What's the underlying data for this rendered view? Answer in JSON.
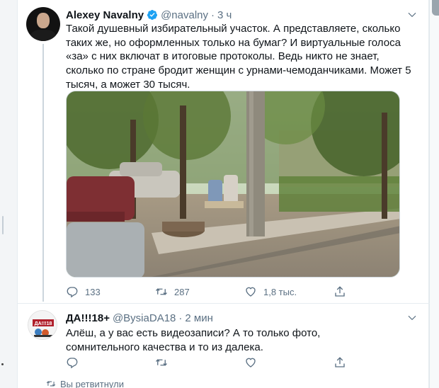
{
  "tweet": {
    "author_name": "Alexey Navalny",
    "handle": "@navalny",
    "separator": "·",
    "time": "3 ч",
    "text": "Такой душевный избирательный участок. А представляете, сколько таких же, но оформленных только на бумаг? И виртуальные голоса «за» с них включат в итоговые протоколы. Ведь никто не знает, сколько по стране бродит женщин с урнами-чемоданчиками. Может 5 тысяч, а может 30 тысяч.",
    "stats": {
      "replies": "133",
      "retweets": "287",
      "likes": "1,8 тыс."
    }
  },
  "reply": {
    "author_name": "ДА!!!18+",
    "handle": "@BysiaDA18",
    "separator": "·",
    "time": "2 мин",
    "text": "Алёш, а у вас есть видеозаписи?  А то только фото, сомнительного качества и то из далека.",
    "avatar_text": "ДА!!!18"
  },
  "footer": {
    "retweeted_by": "Вы ретвитнули"
  },
  "icons": {
    "verified": "verified-badge-icon",
    "more": "chevron-down-icon",
    "reply": "reply-icon",
    "retweet": "retweet-icon",
    "like": "heart-icon",
    "share": "share-icon"
  },
  "colors": {
    "text": "#0f1419",
    "secondary": "#5b7083",
    "verified": "#1da1f2",
    "divider": "#e6ecf0"
  }
}
